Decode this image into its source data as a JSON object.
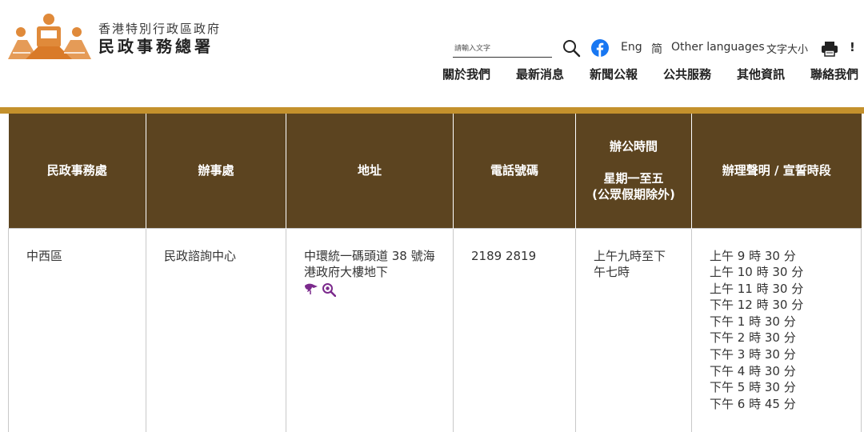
{
  "header": {
    "org_name_line1": "香港特別行政區政府",
    "org_name_line2": "民政事務總署",
    "search_placeholder": "請輸入文字",
    "lang_eng": "Eng",
    "lang_simplified": "简",
    "other_languages": "Other languages",
    "font_size": "文字大小",
    "more": "!"
  },
  "nav": {
    "items": [
      {
        "label": "關於我們"
      },
      {
        "label": "最新消息"
      },
      {
        "label": "新聞公報"
      },
      {
        "label": "公共服務"
      },
      {
        "label": "其他資訊"
      },
      {
        "label": "聯絡我們"
      }
    ]
  },
  "table": {
    "headers": {
      "district": "民政事務處",
      "office": "辦事處",
      "address": "地址",
      "phone": "電話號碼",
      "hours_title": "辦公時間",
      "hours_days": "星期一至五",
      "hours_note": "(公眾假期除外)",
      "declaration": "辦理聲明 / 宣誓時段"
    },
    "rows": [
      {
        "district": "中西區",
        "office": "民政諮詢中心",
        "address": "中環統一碼頭道 38 號海港政府大樓地下",
        "phone": "2189 2819",
        "hours": "上午九時至下午七時",
        "sessions": [
          "上午 9 時 30 分",
          "上午 10 時 30 分",
          "上午 11 時 30 分",
          "下午 12 時 30 分",
          "下午 1 時 30 分",
          "下午 2 時 30 分",
          "下午 3 時 30 分",
          "下午 4 時 30 分",
          "下午 5 時 30 分",
          "下午 6 時 45 分"
        ]
      }
    ]
  },
  "colors": {
    "header_bg": "#5c4420",
    "accent_rule": "#c4912c",
    "logo_orange": "#e08a3a",
    "facebook_blue": "#1877f2",
    "icon_purple": "#7b2a8c"
  },
  "icons": {
    "search": "search-icon",
    "facebook": "facebook-icon",
    "print": "print-icon",
    "location": "location-icon",
    "magnifier": "map-zoom-icon"
  }
}
